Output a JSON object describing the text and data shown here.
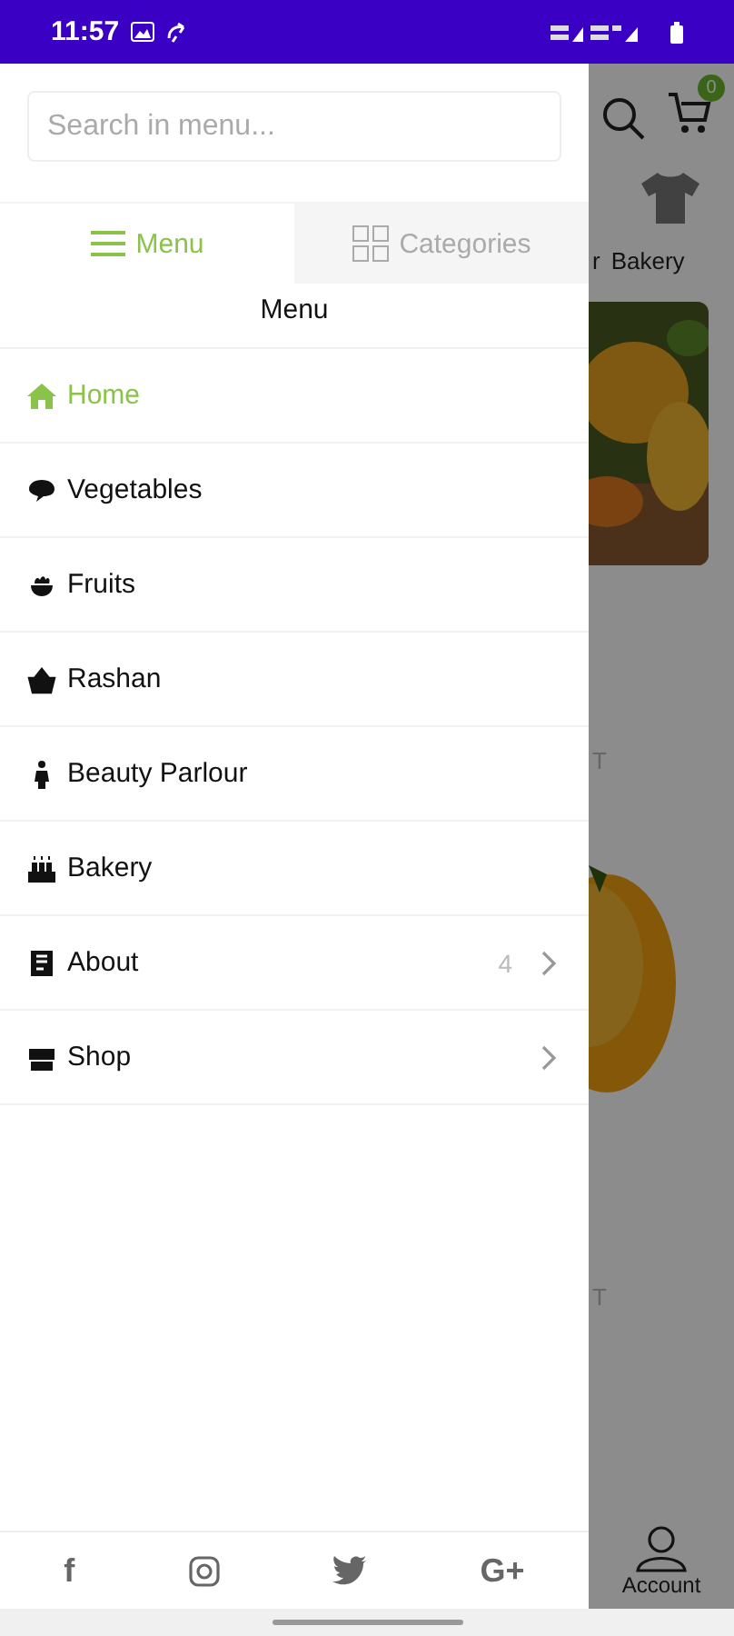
{
  "status_bar": {
    "time": "11:57"
  },
  "drawer": {
    "search": {
      "placeholder": "Search in menu..."
    },
    "tabs": [
      {
        "label": "Menu",
        "selected": true
      },
      {
        "label": "Categories",
        "selected": false
      }
    ],
    "heading": "Menu",
    "items": [
      {
        "label": "Home",
        "selected": true
      },
      {
        "label": "Vegetables",
        "selected": false
      },
      {
        "label": "Fruits",
        "selected": false
      },
      {
        "label": "Rashan",
        "selected": false
      },
      {
        "label": "Beauty Parlour",
        "selected": false
      },
      {
        "label": "Bakery",
        "selected": false
      },
      {
        "label": "About",
        "selected": false,
        "count": "4",
        "expandable": true
      },
      {
        "label": "Shop",
        "selected": false,
        "expandable": true
      }
    ],
    "social": [
      {
        "kind": "letter",
        "text": "f"
      },
      {
        "kind": "instagram"
      },
      {
        "kind": "twitter"
      },
      {
        "kind": "letter",
        "text": "G+"
      }
    ]
  },
  "background": {
    "cart_count": "0",
    "category_label_1": "r",
    "category_label_2": "Bakery",
    "product_text_1": "T",
    "product_text_2": "T",
    "nav_label": "Account"
  }
}
